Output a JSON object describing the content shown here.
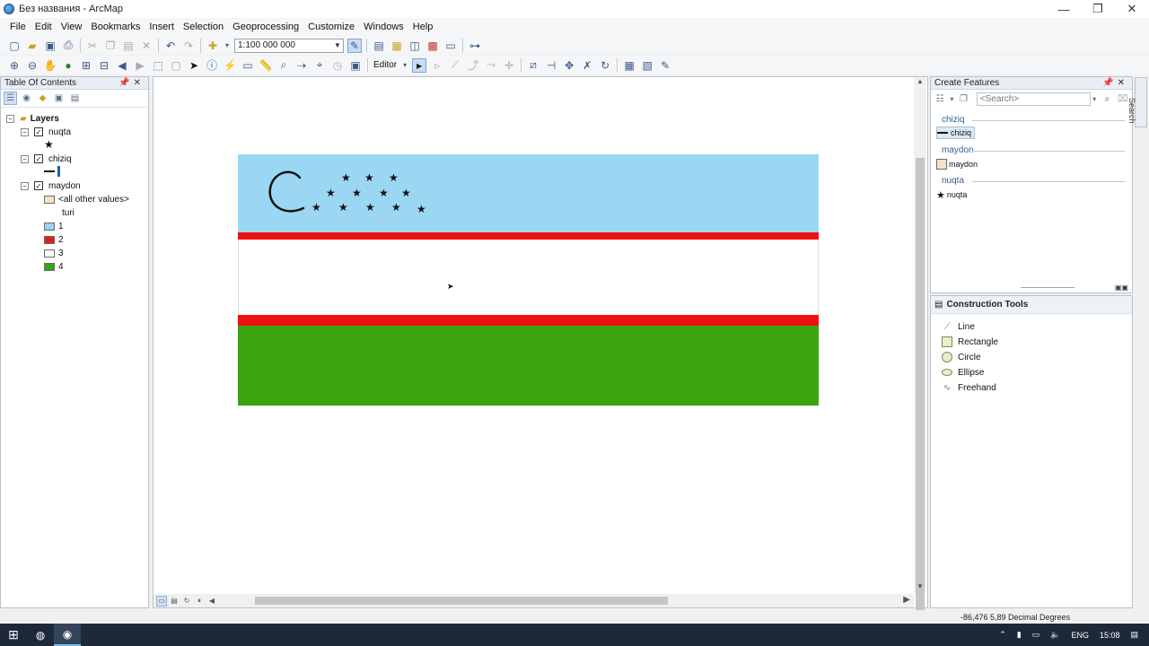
{
  "window": {
    "title": "Без названия - ArcMap",
    "minimize": "—",
    "maximize": "❐",
    "close": "✕"
  },
  "menu": [
    "File",
    "Edit",
    "View",
    "Bookmarks",
    "Insert",
    "Selection",
    "Geoprocessing",
    "Customize",
    "Windows",
    "Help"
  ],
  "toolbar": {
    "scale": "1:100 000 000",
    "editor_label": "Editor"
  },
  "toc": {
    "title": "Table Of Contents",
    "root": "Layers",
    "layers": [
      {
        "name": "nuqta",
        "checked": true,
        "symbol": "★"
      },
      {
        "name": "chiziq",
        "checked": true,
        "symbol": "line"
      },
      {
        "name": "maydon",
        "checked": true,
        "symbol": "polygon"
      }
    ],
    "maydon_legend": {
      "other": "<all other values>",
      "field": "turi",
      "classes": [
        {
          "label": "1",
          "color": "#9bd3f0"
        },
        {
          "label": "2",
          "color": "#e01c1c"
        },
        {
          "label": "3",
          "color": "#ffffff"
        },
        {
          "label": "4",
          "color": "#3aa514"
        }
      ]
    }
  },
  "map": {
    "flag_colors": {
      "blue": "#9bd6f2",
      "red": "#ee1111",
      "white": "#ffffff",
      "green": "#3aa50e"
    },
    "star_rows": [
      3,
      4,
      5
    ]
  },
  "create_features": {
    "title": "Create Features",
    "search_placeholder": "<Search>",
    "groups": [
      {
        "name": "chiziq",
        "template": "chiziq",
        "selected": true
      },
      {
        "name": "maydon",
        "template": "maydon",
        "selected": false
      },
      {
        "name": "nuqta",
        "template": "nuqta",
        "selected": false
      }
    ]
  },
  "construction_tools": {
    "title": "Construction Tools",
    "items": [
      "Line",
      "Rectangle",
      "Circle",
      "Ellipse",
      "Freehand"
    ]
  },
  "side_tab": "Search",
  "status": {
    "coords": "-86,476  5,89 Decimal Degrees"
  },
  "taskbar": {
    "lang": "ENG",
    "time": "15:08"
  }
}
